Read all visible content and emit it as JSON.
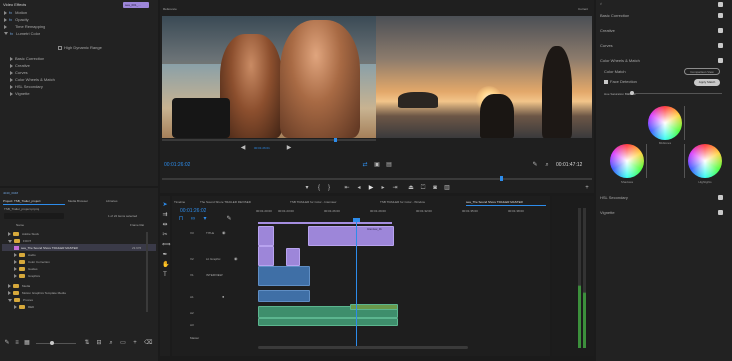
{
  "effect_controls": {
    "header": "Video Effects",
    "items": [
      {
        "label": "Motion",
        "type": "fx"
      },
      {
        "label": "Opacity",
        "type": "fx"
      },
      {
        "label": "Time Remapping",
        "type": "plain"
      },
      {
        "label": "Lumetri Color",
        "type": "fx"
      }
    ],
    "hdr_label": "High Dynamic Range",
    "sections": [
      "Basic Correction",
      "Creative",
      "Curves",
      "Color Wheels & Match",
      "HSL Secondary",
      "Vignette"
    ],
    "clip_tab": "sea_001_..."
  },
  "reference_monitor": {
    "label": "Reference",
    "timecode": "00:01:26:02",
    "center_label": "00:01:26:01"
  },
  "program_monitor": {
    "label": "Current",
    "timecode": "00:01:47:12"
  },
  "project": {
    "tabs": [
      "Project: TSB_Trailer_project",
      "Media Browser",
      "Libraries"
    ],
    "file": "TSB_Trailer_project.prproj",
    "count": "1 of 22 items selected",
    "columns": {
      "name": "Name",
      "rate": "Frame Rat"
    },
    "items": [
      {
        "label": "Adobe Stock",
        "kind": "folder",
        "depth": 0
      },
      {
        "label": "FOOT",
        "kind": "folder",
        "depth": 0
      },
      {
        "label": "sea_The Sound Shore TRAILER MASTER",
        "kind": "sequence",
        "depth": 1,
        "rate": "23.976"
      },
      {
        "label": "Audio",
        "kind": "folder",
        "depth": 1
      },
      {
        "label": "Color Correction",
        "kind": "folder",
        "depth": 1
      },
      {
        "label": "Guides",
        "kind": "folder",
        "depth": 1
      },
      {
        "label": "Graphics",
        "kind": "folder",
        "depth": 1
      },
      {
        "label": "Media",
        "kind": "folder",
        "depth": 0
      },
      {
        "label": "Motion Graphics Template Media",
        "kind": "folder",
        "depth": 0
      },
      {
        "label": "Proxies",
        "kind": "folder",
        "depth": 0
      },
      {
        "label": "RED",
        "kind": "folder",
        "depth": 1
      }
    ],
    "bin_label": "Bin/Seq"
  },
  "timeline": {
    "tabs": [
      "Timeline",
      "The Sound Shore TRAILER REVISED",
      "TSB TRAILER for Color - Interview",
      "TSB TRAILER for Color - Window",
      "sea_The Sound Shore TRAILER MASTER"
    ],
    "timecode": "00:01:26:02",
    "ruler": [
      "00:01:20:00",
      "00:01:23:00",
      "00:01:26:00",
      "00:01:29:00",
      "00:01:32:00",
      "00:01:35:00",
      "00:01:38:00"
    ],
    "video_tracks": [
      "V3",
      "V2",
      "V1"
    ],
    "audio_tracks": [
      "A1",
      "A2",
      "A3"
    ],
    "track_names": [
      "TITLE",
      "Lit Graphic",
      "INTERVIEW"
    ],
    "master_label": "Master",
    "clip_label": "Interview_01"
  },
  "lumetri": {
    "sections": [
      "Basic Correction",
      "Creative",
      "Curves",
      "Color Wheels & Match"
    ],
    "color_match": "Color Match",
    "comparison_view": "Comparison View",
    "face_detection": "Face Detection",
    "apply_match": "Apply Match",
    "hue_label": "Hue Saturation Balance",
    "wheels": [
      "Midtones",
      "Shadows",
      "Highlights"
    ],
    "bottom_sections": [
      "HSL Secondary",
      "Vignette"
    ]
  },
  "status": {
    "label": "4040_0048"
  }
}
